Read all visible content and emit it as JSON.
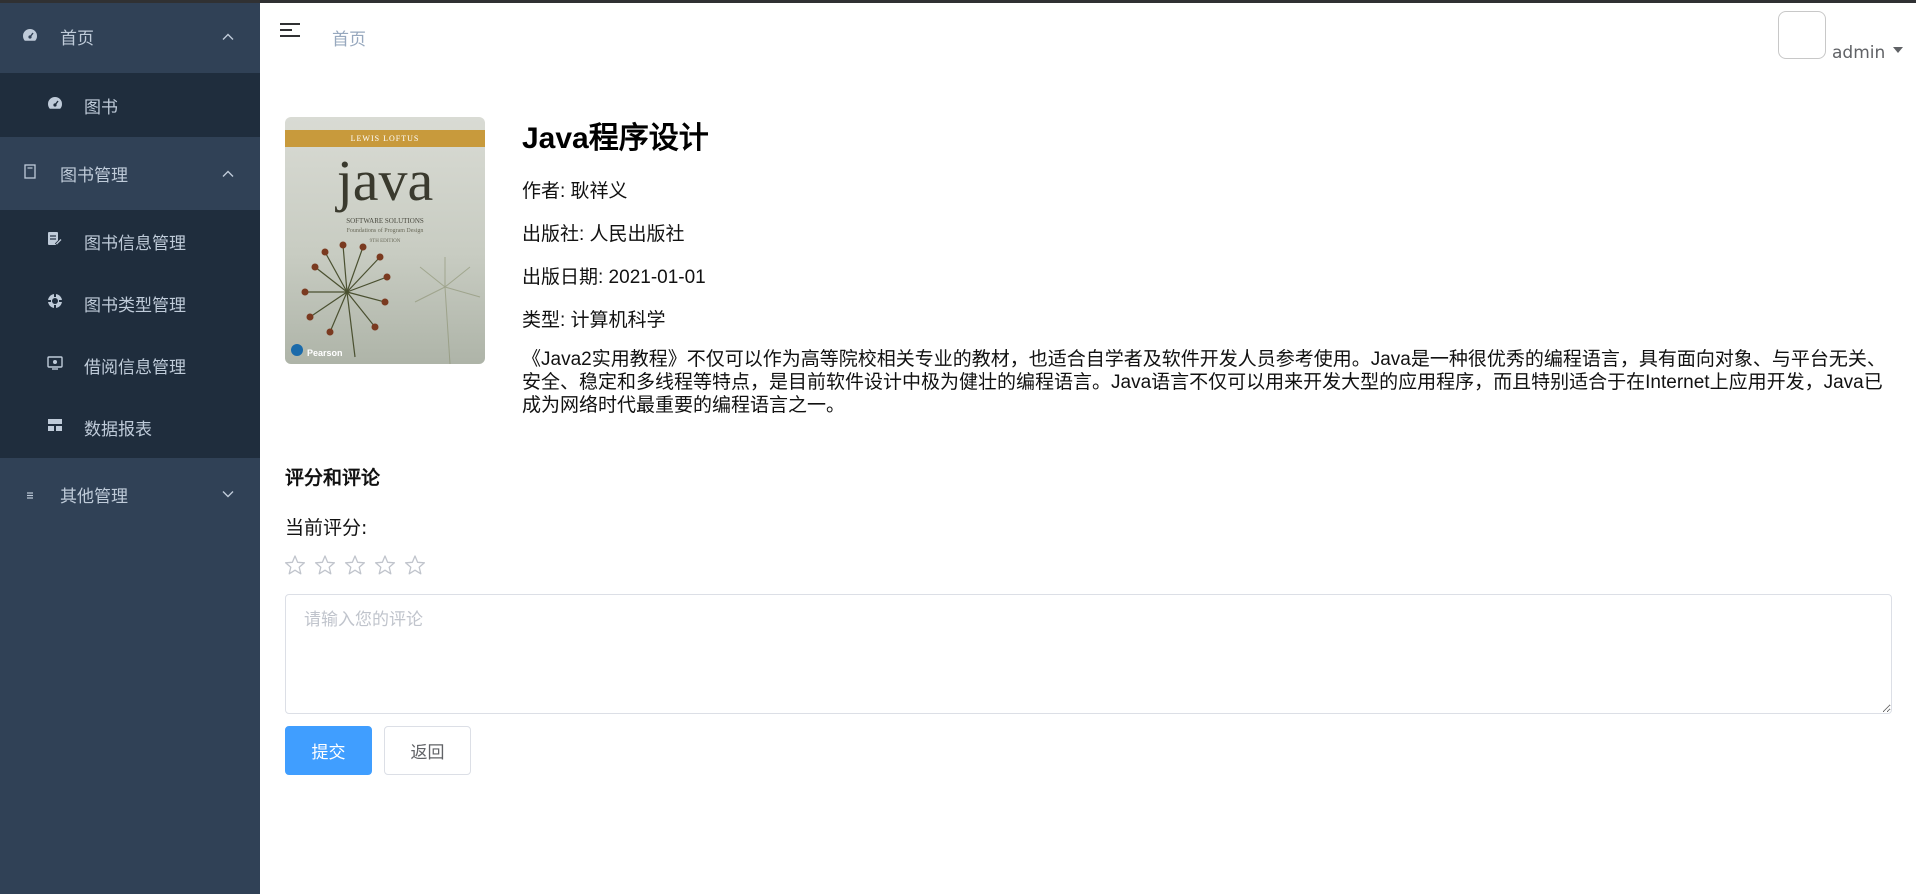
{
  "sidebar": {
    "groups": [
      {
        "label": "首页",
        "icon": "dashboard-icon",
        "expanded": true,
        "items": [
          {
            "label": "图书",
            "icon": "dashboard-icon"
          }
        ]
      },
      {
        "label": "图书管理",
        "icon": "document-icon",
        "expanded": true,
        "items": [
          {
            "label": "图书信息管理",
            "icon": "edit-icon"
          },
          {
            "label": "图书类型管理",
            "icon": "category-icon"
          },
          {
            "label": "借阅信息管理",
            "icon": "borrow-icon"
          },
          {
            "label": "数据报表",
            "icon": "report-icon"
          }
        ]
      },
      {
        "label": "其他管理",
        "icon": "list-icon",
        "expanded": false,
        "items": []
      }
    ],
    "colors": {
      "bg": "#304156",
      "submenu_bg": "#1f2d3d",
      "text": "#bfcbd9"
    }
  },
  "header": {
    "breadcrumb": "首页",
    "user": {
      "name": "admin"
    }
  },
  "book": {
    "cover": {
      "band_text": "LEWIS  LOFTUS",
      "title": "java",
      "subtitle": "SOFTWARE SOLUTIONS",
      "tagline": "Foundations of Program Design",
      "edition": "9TH EDITION",
      "publisher": "Pearson"
    },
    "title": "Java程序设计",
    "author": "作者: 耿祥义",
    "publisher": "出版社: 人民出版社",
    "publish_date": "出版日期: 2021-01-01",
    "category": "类型: 计算机科学",
    "description": "《Java2实用教程》不仅可以作为高等院校相关专业的教材，也适合自学者及软件开发人员参考使用。Java是一种很优秀的编程语言，具有面向对象、与平台无关、安全、稳定和多线程等特点，是目前软件设计中极为健壮的编程语言。Java语言不仅可以用来开发大型的应用程序，而且特别适合于在Internet上应用开发，Java已成为网络时代最重要的编程语言之一。"
  },
  "review": {
    "section_title": "评分和评论",
    "rating_label": "当前评分:",
    "rating": 0,
    "max_rating": 5,
    "comment_placeholder": "请输入您的评论",
    "comment_value": "",
    "submit_label": "提交",
    "back_label": "返回"
  },
  "colors": {
    "primary": "#409eff",
    "star_empty": "#c0c4cc"
  }
}
